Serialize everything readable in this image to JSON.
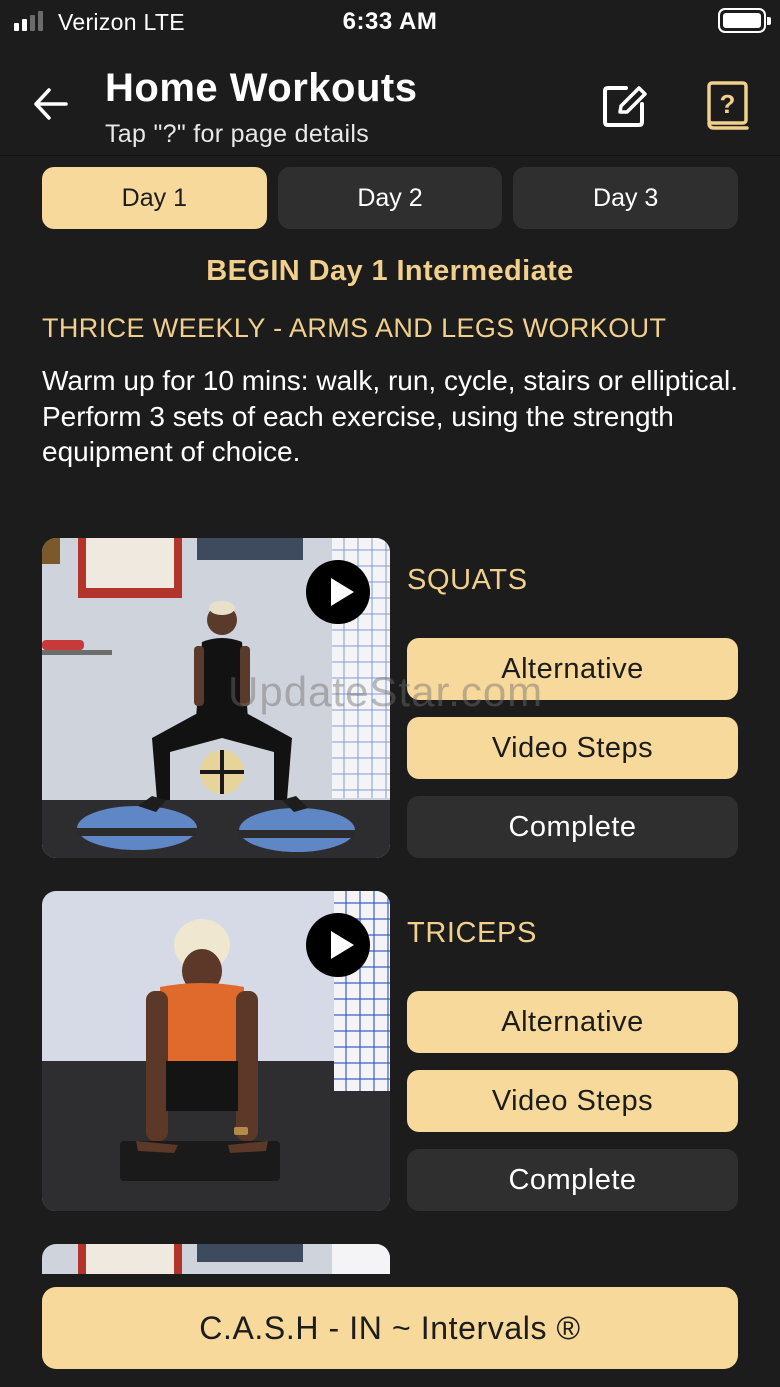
{
  "status_bar": {
    "carrier": "Verizon  LTE",
    "time": "6:33 AM"
  },
  "header": {
    "title": "Home Workouts",
    "subtitle": "Tap \"?\" for page details",
    "icons": [
      "back-arrow-icon",
      "edit-icon",
      "help-book-icon"
    ]
  },
  "tabs": [
    {
      "label": "Day 1",
      "active": true
    },
    {
      "label": "Day 2",
      "active": false
    },
    {
      "label": "Day 3",
      "active": false
    }
  ],
  "day_heading": "BEGIN Day 1 Intermediate",
  "workout_title": "THRICE WEEKLY - ARMS AND LEGS WORKOUT",
  "instructions": "Warm up for 10 mins: walk, run, cycle, stairs or elliptical.\n Perform 3 sets of each exercise, using the strength equipment of choice.",
  "exercises": [
    {
      "name": "SQUATS",
      "alternative": "Alternative",
      "video_steps": "Video Steps",
      "complete": "Complete"
    },
    {
      "name": "TRICEPS",
      "alternative": "Alternative",
      "video_steps": "Video Steps",
      "complete": "Complete"
    }
  ],
  "watermark": "UpdateStar.com",
  "cash_button": "C.A.S.H - IN ~ Intervals ®",
  "colors": {
    "background": "#1c1c1c",
    "accent": "#f6d99b",
    "accent_text": "#f1cf8c",
    "button_dark": "#2f2f2f"
  }
}
